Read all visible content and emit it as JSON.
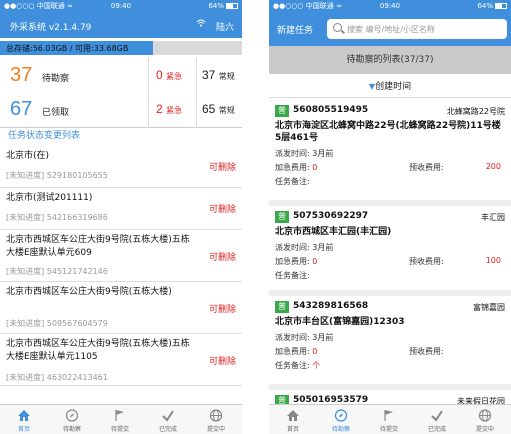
{
  "left": {
    "status": {
      "carrier": "●●○○○ 中国联通 ≈",
      "time": "09:40",
      "battery": "64%",
      "battery_level": 0.64
    },
    "header": {
      "app_title": "外采系统 v2.1.4.79",
      "user": "陆六"
    },
    "storage": {
      "text": "总存储:56.03GB / 可用:33.68GB",
      "used_fraction": 0.63
    },
    "pending": {
      "count": "37",
      "label": "待勘察",
      "urgent_count": "0",
      "urgent_label": "紧急",
      "normal_count": "37",
      "normal_label": "常规"
    },
    "claimed": {
      "count": "67",
      "label": "已领取",
      "urgent_count": "2",
      "urgent_label": "紧急",
      "normal_count": "65",
      "normal_label": "常规"
    },
    "section_title": "任务状态变更列表",
    "items": [
      {
        "address": "北京市(在)",
        "meta": "[未知进度]  529180105655",
        "action": "可删除"
      },
      {
        "address": "北京市(测试201111)",
        "meta": "[未知进度]  542166319686",
        "action": "可删除"
      },
      {
        "address": "北京市西城区车公庄大街9号院(五栋大楼)五栋大楼E座默认单元609",
        "meta": "[未知进度]  545121742146",
        "action": "可删除"
      },
      {
        "address": "北京市西城区车公庄大街9号院(五栋大楼)",
        "meta": "[未知进度]  509567604579",
        "action": "可删除"
      },
      {
        "address": "北京市西城区车公庄大街9号院(五栋大楼)五栋大楼E座默认单元1105",
        "meta": "[未知进度]  463022413461",
        "action": "可删除"
      }
    ],
    "tabs": [
      {
        "label": "首页",
        "icon": "home-icon"
      },
      {
        "label": "待勘察",
        "icon": "compass-icon"
      },
      {
        "label": "待提交",
        "icon": "flag-icon"
      },
      {
        "label": "已完成",
        "icon": "check-icon"
      },
      {
        "label": "提交中",
        "icon": "globe-icon"
      }
    ]
  },
  "right": {
    "status": {
      "carrier": "●●○○○ 中国联通 ≈",
      "time": "09:40",
      "battery": "64%",
      "battery_level": 0.64
    },
    "header": {
      "new_task": "新建任务",
      "search_placeholder": "搜索 编号/地址/小区名称"
    },
    "pending_title": "待勘察的列表(37/37)",
    "sort_label": "创建时间",
    "labels": {
      "dispatch_time": "派发时间:",
      "urgent_fee": "加急费用:",
      "expected_fee": "预收费用:",
      "remark": "任务备注:"
    },
    "cards": [
      {
        "badge": "普",
        "code": "560805519495",
        "place": "北蜂窝路22号院",
        "address": "北京市海淀区北蜂窝中路22号(北蜂窝路22号院)11号楼5层461号",
        "dispatch": "3月前",
        "urgent_fee": "0",
        "expected_fee": "200",
        "remark": ""
      },
      {
        "badge": "普",
        "code": "507530692297",
        "place": "丰汇园",
        "address": "北京市西城区丰汇园(丰汇园)",
        "dispatch": "3月前",
        "urgent_fee": "0",
        "expected_fee": "100",
        "remark": ""
      },
      {
        "badge": "普",
        "code": "543289816568",
        "place": "富锦嘉园",
        "address": "北京市丰台区(富锦嘉园)12303",
        "dispatch": "3月前",
        "urgent_fee": "0",
        "expected_fee": "",
        "remark": "个"
      },
      {
        "badge": "普",
        "code": "505016953579",
        "place": "未来假日花园",
        "address": "",
        "dispatch": "",
        "urgent_fee": "",
        "expected_fee": "",
        "remark": ""
      }
    ],
    "tabs": [
      {
        "label": "首页",
        "icon": "home-icon"
      },
      {
        "label": "待勘察",
        "icon": "compass-icon"
      },
      {
        "label": "待提交",
        "icon": "flag-icon"
      },
      {
        "label": "已完成",
        "icon": "check-icon"
      },
      {
        "label": "提交中",
        "icon": "globe-icon"
      }
    ]
  },
  "colors": {
    "brand": "#3f8fdc",
    "urgent": "#e02020",
    "badge": "#3aa84b",
    "pending_number": "#f08020",
    "claimed_number": "#3f8fdc"
  }
}
